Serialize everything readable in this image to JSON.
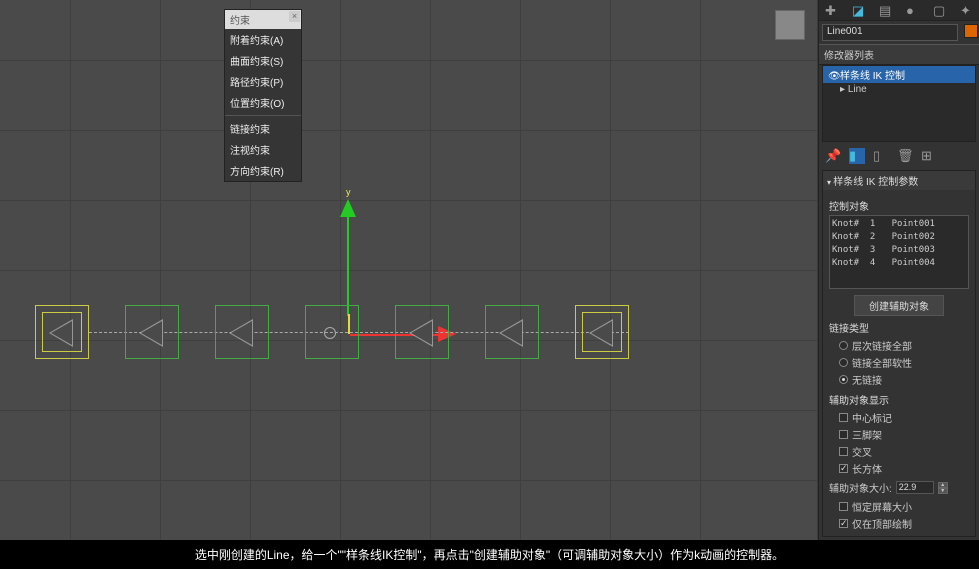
{
  "viewport": {
    "axis_y": "y"
  },
  "context_menu": {
    "header": "约束",
    "items": [
      "附着约束(A)",
      "曲面约束(S)",
      "路径约束(P)",
      "位置约束(O)"
    ],
    "items2": [
      "链接约束",
      "注视约束",
      "方向约束(R)"
    ]
  },
  "panel": {
    "object_name": "Line001",
    "modifier_header": "修改器列表",
    "mod_items": [
      {
        "label": "样条线 IK 控制",
        "selected": true
      },
      {
        "label": "Line",
        "selected": false
      }
    ],
    "rollup_title": "样条线 IK 控制参数",
    "knot_label": "控制对象",
    "knots": "Knot#  1   Point001\nKnot#  2   Point002\nKnot#  3   Point003\nKnot#  4   Point004",
    "create_btn": "创建辅助对象",
    "link_type_label": "链接类型",
    "link_opts": [
      "层次链接全部",
      "链接全部软性",
      "无链接"
    ],
    "helper_display_label": "辅助对象显示",
    "display_opts": [
      "中心标记",
      "三脚架",
      "交叉",
      "长方体"
    ],
    "size_label": "辅助对象大小:",
    "size_value": "22.9",
    "const_label": "恒定屏幕大小",
    "draw_label": "仅在顶部绘制"
  },
  "footer": {
    "text": "选中刚创建的Line，给一个\"\"样条线IK控制\"，再点击\"创建辅助对象\"（可调辅助对象大小）作为k动画的控制器。"
  }
}
